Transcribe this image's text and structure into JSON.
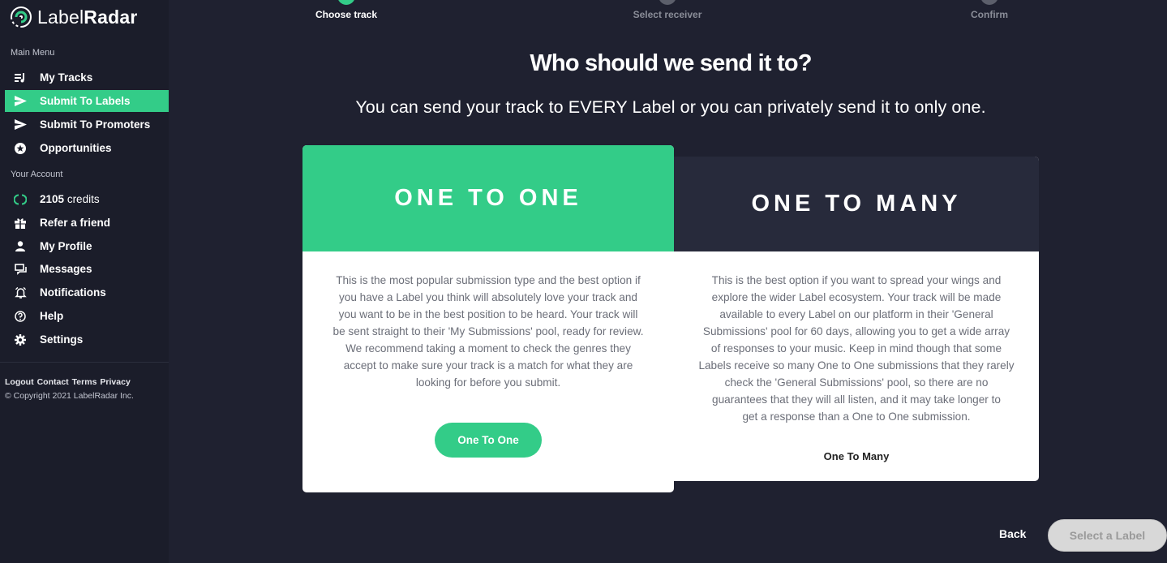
{
  "brand": {
    "name_light": "Label",
    "name_bold": "Radar",
    "accent": "#33cc88"
  },
  "sidebar": {
    "main_menu_label": "Main Menu",
    "main_items": [
      {
        "label": "My Tracks",
        "icon": "playlist-icon"
      },
      {
        "label": "Submit To Labels",
        "icon": "send-icon",
        "active": true
      },
      {
        "label": "Submit To Promoters",
        "icon": "send-icon"
      },
      {
        "label": "Opportunities",
        "icon": "star-circle-icon"
      }
    ],
    "account_label": "Your Account",
    "credits_value": "2105",
    "credits_unit": "credits",
    "account_items": [
      {
        "label": "Refer a friend",
        "icon": "gift-icon"
      },
      {
        "label": "My Profile",
        "icon": "user-icon"
      },
      {
        "label": "Messages",
        "icon": "chat-icon"
      },
      {
        "label": "Notifications",
        "icon": "bell-icon"
      },
      {
        "label": "Help",
        "icon": "help-circle-icon"
      },
      {
        "label": "Settings",
        "icon": "gear-icon"
      }
    ],
    "footer_links": [
      "Logout",
      "Contact",
      "Terms",
      "Privacy"
    ],
    "copyright": "© Copyright 2021 LabelRadar Inc."
  },
  "stepper": {
    "steps": [
      {
        "label": "Choose track",
        "state": "complete"
      },
      {
        "label": "Select receiver",
        "state": "pending"
      },
      {
        "label": "Confirm",
        "state": "pending"
      }
    ]
  },
  "heading": {
    "title": "Who should we send it to?",
    "subtitle": "You can send your track to EVERY Label or you can privately send it to only one."
  },
  "cards": {
    "one_to_one": {
      "title": "ONE TO ONE",
      "header_color": "#33cc88",
      "lines": [
        "This is the most popular submission type and the best option if",
        "you have a Label you think will absolutely love your track and",
        "you want to be in the best position to be heard. Your track will",
        "be sent straight to their 'My Submissions' pool, ready for review.",
        "We recommend taking a moment to check the genres they",
        "accept to make sure your track is a match for what they are",
        "looking for before you submit."
      ],
      "button_label": "One To One"
    },
    "one_to_many": {
      "title": "ONE TO MANY",
      "header_color": "#272a3b",
      "lines": [
        "This is the best option if you want to spread your wings and",
        "explore the wider Label ecosystem. Your track will be made",
        "available to every Label on our platform in their 'General",
        "Submissions' pool for 60 days, allowing you to get a wide array",
        "of responses to your music. Keep in mind though that some",
        "Labels receive so many One to One submissions that they rarely",
        "check the 'General Submissions' pool, so there are no",
        "guarantees that they will all listen, and it may take longer to",
        "get a response than a One to One submission."
      ],
      "button_label": "One To Many"
    }
  },
  "actions": {
    "back_label": "Back",
    "select_label": "Select a Label"
  }
}
